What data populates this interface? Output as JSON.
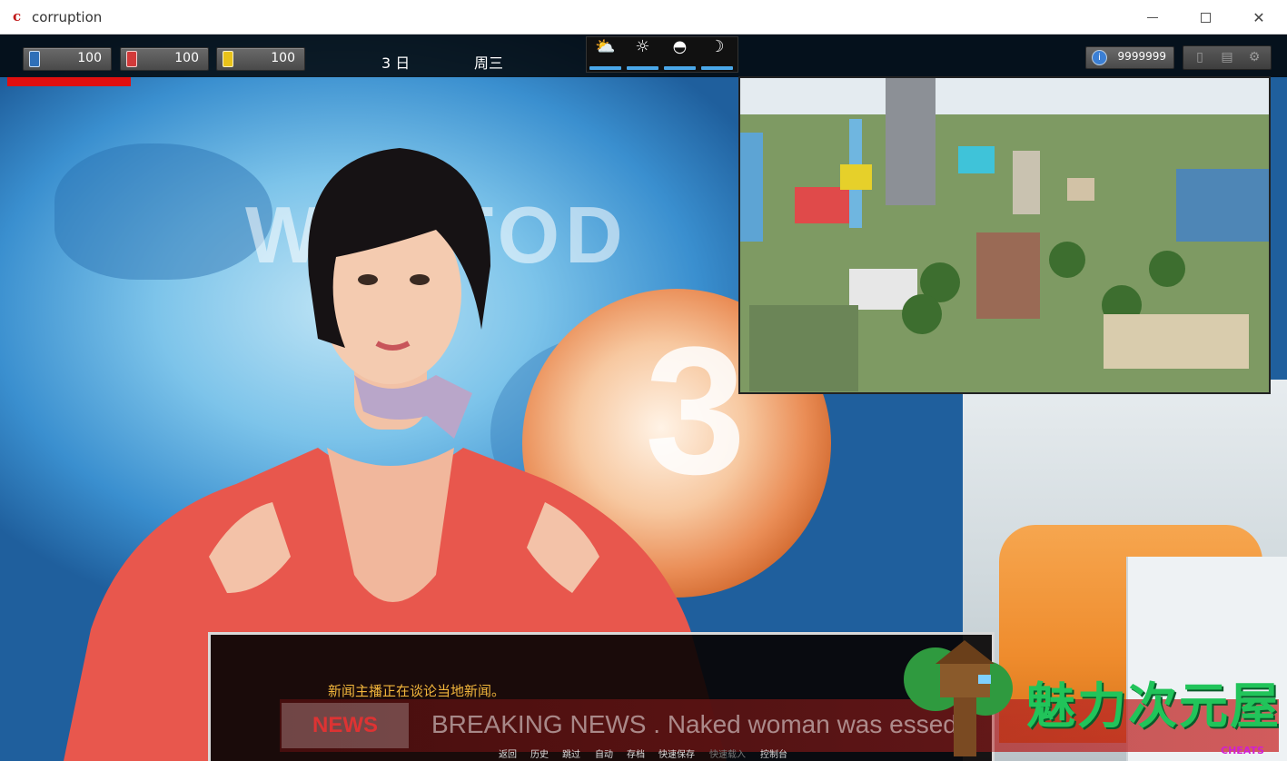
{
  "window": {
    "icon_letter": "c",
    "title": "corruption",
    "minimize_icon": "minimize-icon",
    "maximize_icon": "maximize-icon",
    "close_glyph": "✕"
  },
  "hud": {
    "stats": [
      {
        "icon": "blue-bottle-icon",
        "color": "#2f6fb8",
        "value": "100"
      },
      {
        "icon": "red-bottle-icon",
        "color": "#d23a3a",
        "value": "100"
      },
      {
        "icon": "yellow-bottle-icon",
        "color": "#e8c21a",
        "value": "100"
      }
    ],
    "day": "3 日",
    "weekday": "周三",
    "time_of_day": [
      {
        "icon": "cloudy-sun-icon",
        "glyph": "⛅"
      },
      {
        "icon": "sun-icon",
        "glyph": "☼"
      },
      {
        "icon": "sunset-icon",
        "glyph": "◓"
      },
      {
        "icon": "moon-icon",
        "glyph": "☽"
      }
    ],
    "money": "9999999",
    "system_buttons": [
      {
        "icon": "phone-icon",
        "glyph": "▯"
      },
      {
        "icon": "computer-icon",
        "glyph": "▤"
      },
      {
        "icon": "gear-icon",
        "glyph": "⚙"
      }
    ],
    "accent_red": "#e10f0f",
    "accent_blue": "#4aa7e8"
  },
  "scene": {
    "backdrop_text": "W      D TOD",
    "backdrop_number": "3"
  },
  "dialogue": {
    "text": "新闻主播正在谈论当地新闻。",
    "text_color": "#f2b63c",
    "news_logo": "NEWS",
    "news_ticker": "BREAKING NEWS . Naked woman was       essed",
    "quick_menu": [
      "返回",
      "历史",
      "跳过",
      "自动",
      "存档",
      "快速保存",
      "快速载入",
      "控制台"
    ]
  },
  "watermark": {
    "text": "魅力次元屋",
    "sub": "CHEATS"
  }
}
